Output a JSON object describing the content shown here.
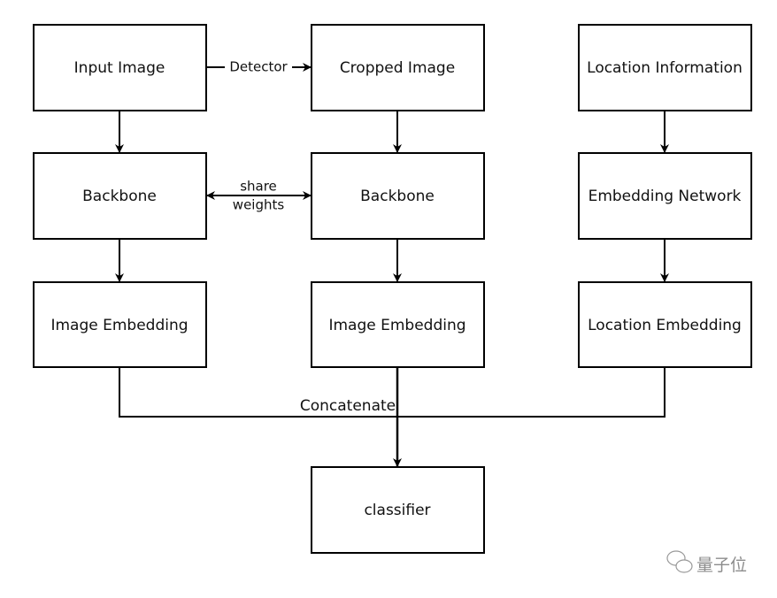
{
  "nodes": {
    "input_image": "Input Image",
    "cropped_image": "Cropped Image",
    "location_information": "Location Information",
    "backbone_1": "Backbone",
    "backbone_2": "Backbone",
    "embedding_network": "Embedding Network",
    "image_embedding_1": "Image Embedding",
    "image_embedding_2": "Image Embedding",
    "location_embedding": "Location Embedding",
    "classifier": "classifier"
  },
  "edges": {
    "detector": "Detector",
    "share": "share",
    "weights": "weights",
    "concatenate": "Concatenate"
  },
  "watermark": "量子位"
}
